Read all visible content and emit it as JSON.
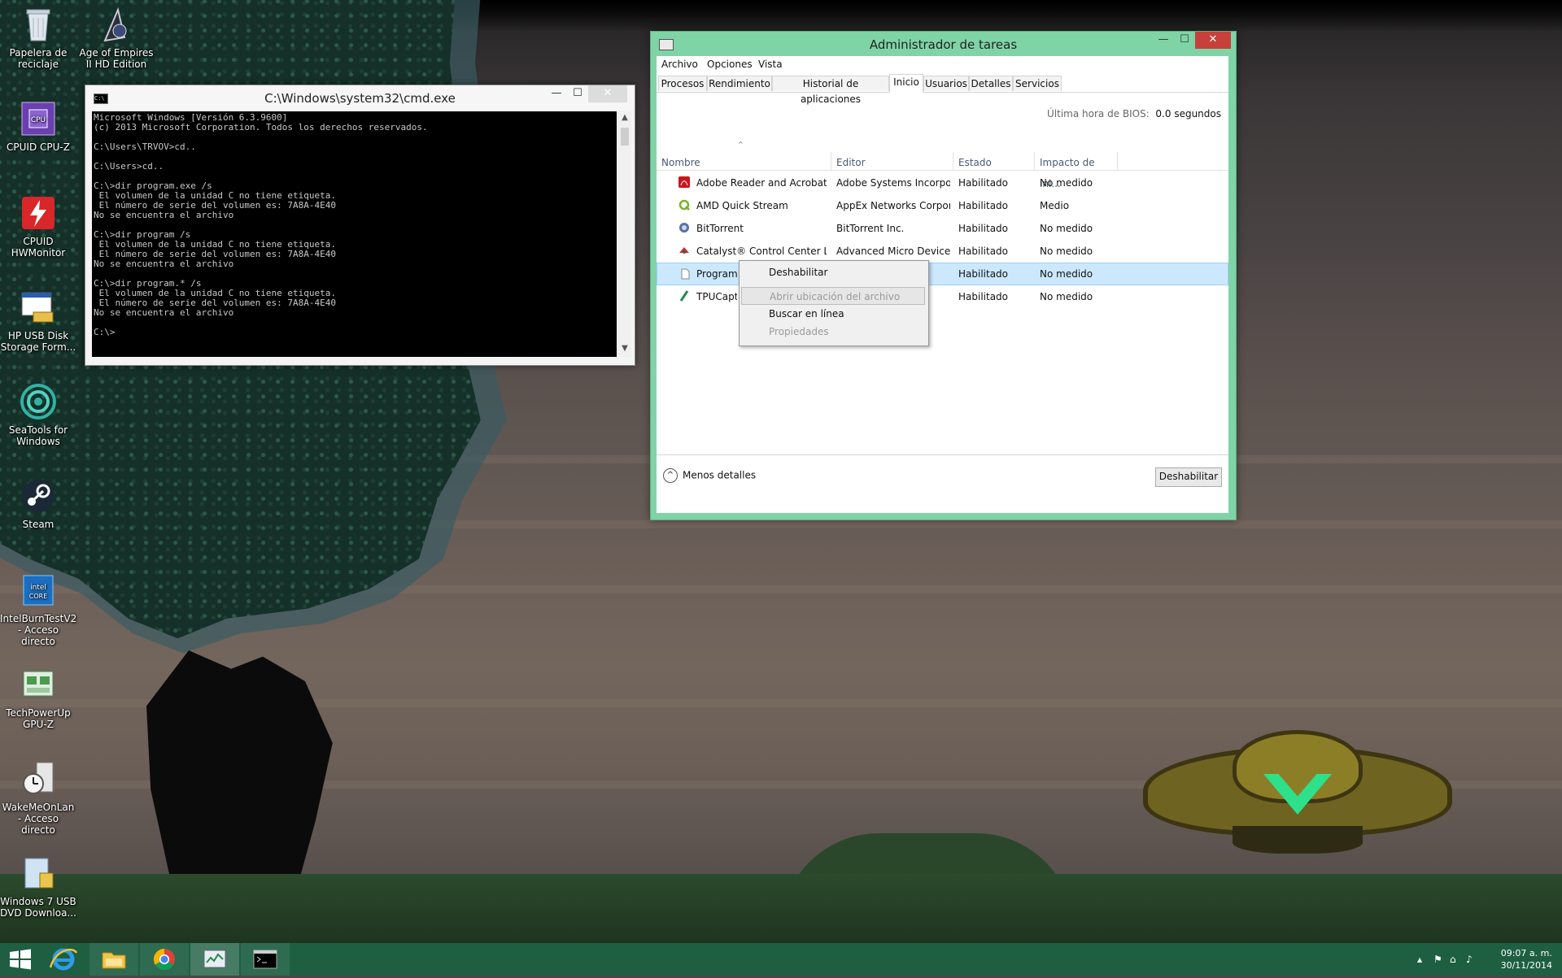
{
  "desktop_icons": [
    {
      "name": "recycle-bin",
      "label": "Papelera de reciclaje"
    },
    {
      "name": "age-of-empires",
      "label": "Age of Empires II HD Edition"
    },
    {
      "name": "cpuz",
      "label": "CPUID CPU-Z"
    },
    {
      "name": "hwmonitor",
      "label": "CPUID HWMonitor"
    },
    {
      "name": "hp-usb",
      "label": "HP USB Disk Storage Form..."
    },
    {
      "name": "seatools",
      "label": "SeaTools for Windows"
    },
    {
      "name": "steam",
      "label": "Steam"
    },
    {
      "name": "intelburntest",
      "label": "IntelBurnTestV2 - Acceso directo"
    },
    {
      "name": "gpuz",
      "label": "TechPowerUp GPU-Z"
    },
    {
      "name": "wakemeonlan",
      "label": "WakeMeOnLan - Acceso directo"
    },
    {
      "name": "win7usb",
      "label": "Windows 7 USB DVD Downloa..."
    }
  ],
  "cmd": {
    "title": "C:\\Windows\\system32\\cmd.exe",
    "icon_text": "C:\\",
    "minimize": "—",
    "maximize": "☐",
    "close": "✕",
    "console_text": "Microsoft Windows [Versión 6.3.9600]\n(c) 2013 Microsoft Corporation. Todos los derechos reservados.\n\nC:\\Users\\TRVOV>cd..\n\nC:\\Users>cd..\n\nC:\\>dir program.exe /s\n El volumen de la unidad C no tiene etiqueta.\n El número de serie del volumen es: 7A8A-4E40\nNo se encuentra el archivo\n\nC:\\>dir program /s\n El volumen de la unidad C no tiene etiqueta.\n El número de serie del volumen es: 7A8A-4E40\nNo se encuentra el archivo\n\nC:\\>dir program.* /s\n El volumen de la unidad C no tiene etiqueta.\n El número de serie del volumen es: 7A8A-4E40\nNo se encuentra el archivo\n\nC:\\>",
    "scroll_up": "▲",
    "scroll_down": "▼"
  },
  "taskmgr": {
    "title": "Administrador de tareas",
    "minimize": "—",
    "maximize": "☐",
    "close": "✕",
    "menu": {
      "file": "Archivo",
      "options": "Opciones",
      "view": "Vista"
    },
    "tabs": [
      "Procesos",
      "Rendimiento",
      "Historial de aplicaciones",
      "Inicio",
      "Usuarios",
      "Detalles",
      "Servicios"
    ],
    "active_tab": "Inicio",
    "bios_label": "Última hora de BIOS:",
    "bios_value": "0.0 segundos",
    "sort_arrow": "^",
    "columns": {
      "name": "Nombre",
      "publisher": "Editor",
      "status": "Estado",
      "impact": "Impacto de ini..."
    },
    "rows": [
      {
        "name": "Adobe Reader and Acrobat ...",
        "publisher": "Adobe Systems Incorpor...",
        "status": "Habilitado",
        "impact": "No medido",
        "icon": "adobe-icon"
      },
      {
        "name": "AMD Quick Stream",
        "publisher": "AppEx Networks Corpor...",
        "status": "Habilitado",
        "impact": "Medio",
        "icon": "quickstream-icon"
      },
      {
        "name": "BitTorrent",
        "publisher": "BitTorrent Inc.",
        "status": "Habilitado",
        "impact": "No medido",
        "icon": "bittorrent-icon"
      },
      {
        "name": "Catalyst® Control Center La...",
        "publisher": "Advanced Micro Device...",
        "status": "Habilitado",
        "impact": "No medido",
        "icon": "catalyst-icon"
      },
      {
        "name": "Program",
        "publisher": "",
        "status": "Habilitado",
        "impact": "No medido",
        "icon": "blank-file-icon",
        "selected": true
      },
      {
        "name": "TPUCapt",
        "publisher": "",
        "status": "Habilitado",
        "impact": "No medido",
        "icon": "tpucapture-icon"
      }
    ],
    "less_details": "Menos detalles",
    "less_details_glyph": "^",
    "disable_button": "Deshabilitar"
  },
  "context_menu": {
    "items": [
      {
        "label": "Deshabilitar",
        "enabled": true
      },
      {
        "label": "Abrir ubicación del archivo",
        "enabled": false,
        "highlighted": true
      },
      {
        "label": "Buscar en línea",
        "enabled": true
      },
      {
        "label": "Propiedades",
        "enabled": false
      }
    ]
  },
  "taskbar": {
    "clock_time": "09:07 a. m.",
    "clock_date": "30/11/2014",
    "tray_glyphs": {
      "chevron": "▲",
      "flag": "⚑",
      "network": "⌂",
      "volume": "♪"
    },
    "colors": {
      "background": "#1e5f42",
      "accent": "#7fd4a6"
    }
  }
}
